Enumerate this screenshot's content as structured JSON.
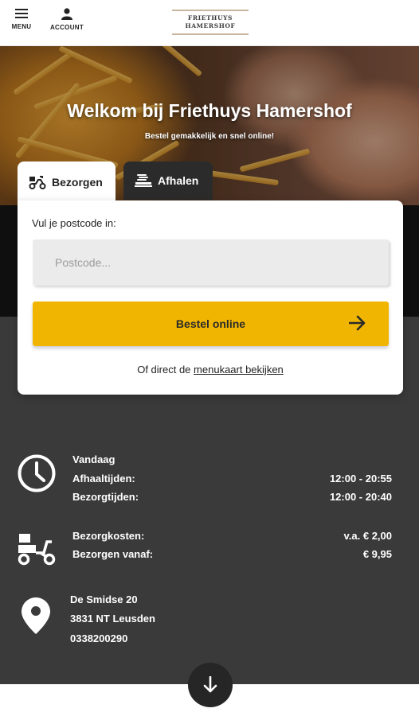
{
  "header": {
    "menu_label": "MENU",
    "account_label": "ACCOUNT",
    "logo_line1": "FRIETHUYS",
    "logo_line2": "HAMERSHOF"
  },
  "hero": {
    "title": "Welkom bij Friethuys Hamershof",
    "subtitle": "Bestel gemakkelijk en snel online!"
  },
  "tabs": {
    "deliver_label": "Bezorgen",
    "pickup_label": "Afhalen",
    "active": "Bezorgen"
  },
  "order_form": {
    "postcode_label": "Vul je postcode in:",
    "postcode_placeholder": "Postcode...",
    "postcode_value": "",
    "order_button_label": "Bestel online",
    "menu_prefix": "Of direct de",
    "menu_link_label": "menukaart bekijken"
  },
  "info": {
    "today_label": "Vandaag",
    "pickup_times_label": "Afhaaltijden:",
    "pickup_times_value": "12:00 - 20:55",
    "delivery_times_label": "Bezorgtijden:",
    "delivery_times_value": "12:00 - 20:40",
    "delivery_cost_label": "Bezorgkosten:",
    "delivery_cost_value": "v.a. € 2,00",
    "min_order_label": "Bezorgen vanaf:",
    "min_order_value": "€ 9,95",
    "address_street": "De Smidse 20",
    "address_city": "3831 NT Leusden",
    "phone": "0338200290"
  },
  "colors": {
    "accent": "#f0b500",
    "dark_section": "#3a3a3a",
    "tab_inactive": "#2b2b2b"
  },
  "icons": [
    "menu-icon",
    "account-icon",
    "scooter-icon",
    "food-tray-icon",
    "arrow-right-icon",
    "clock-icon",
    "delivery-scooter-icon",
    "location-pin-icon",
    "arrow-down-icon"
  ]
}
